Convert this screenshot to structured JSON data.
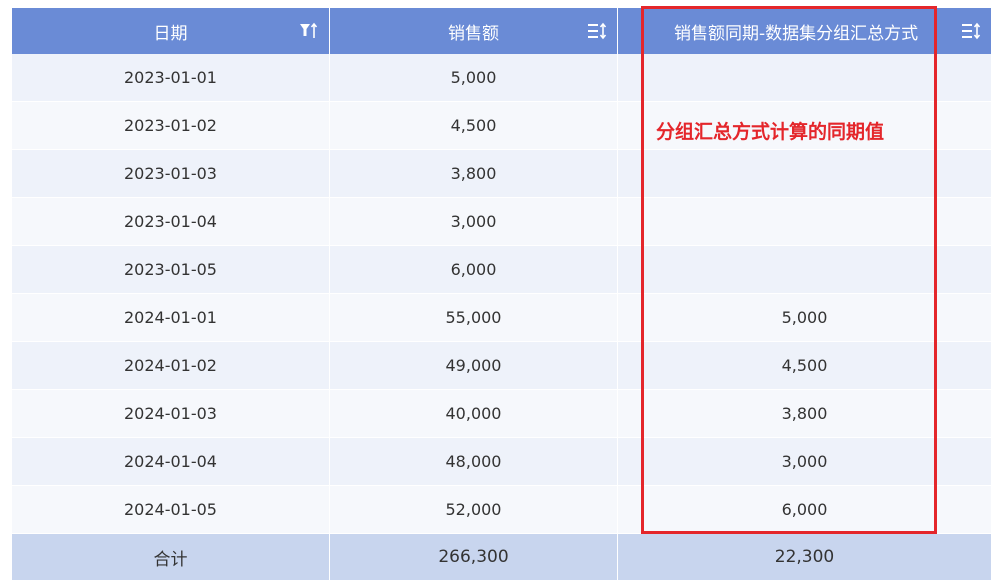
{
  "table": {
    "headers": [
      {
        "label": "日期",
        "icon": "filter-sort-icon"
      },
      {
        "label": "销售额",
        "icon": "sort-icon"
      },
      {
        "label": "销售额同期-数据集分组汇总方式",
        "icon": "sort-icon"
      }
    ],
    "rows": [
      {
        "date": "2023-01-01",
        "sales": "5,000",
        "yoy": ""
      },
      {
        "date": "2023-01-02",
        "sales": "4,500",
        "yoy": ""
      },
      {
        "date": "2023-01-03",
        "sales": "3,800",
        "yoy": ""
      },
      {
        "date": "2023-01-04",
        "sales": "3,000",
        "yoy": ""
      },
      {
        "date": "2023-01-05",
        "sales": "6,000",
        "yoy": ""
      },
      {
        "date": "2024-01-01",
        "sales": "55,000",
        "yoy": "5,000"
      },
      {
        "date": "2024-01-02",
        "sales": "49,000",
        "yoy": "4,500"
      },
      {
        "date": "2024-01-03",
        "sales": "40,000",
        "yoy": "3,800"
      },
      {
        "date": "2024-01-04",
        "sales": "48,000",
        "yoy": "3,000"
      },
      {
        "date": "2024-01-05",
        "sales": "52,000",
        "yoy": "6,000"
      }
    ],
    "total": {
      "label": "合计",
      "sales": "266,300",
      "yoy": "22,300"
    }
  },
  "annotation": {
    "text": "分组汇总方式计算的同期值",
    "color": "#e4262b"
  },
  "colors": {
    "header_bg": "#6a8bd6",
    "row_odd_bg": "#eef2fa",
    "row_even_bg": "#f6f8fc",
    "total_bg": "#c8d5ee",
    "highlight": "#e4262b"
  }
}
